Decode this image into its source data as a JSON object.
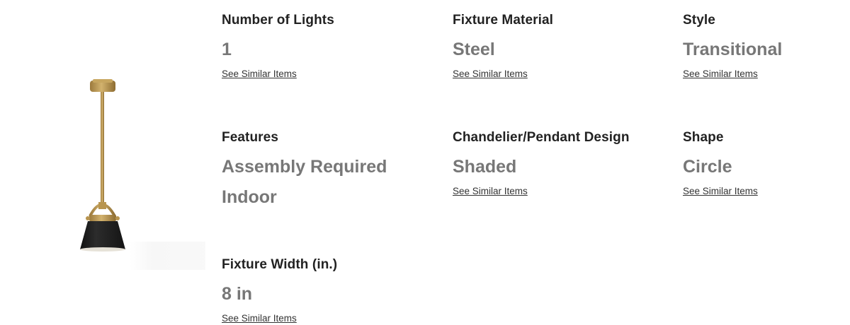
{
  "specs": {
    "number_of_lights": {
      "title": "Number of Lights",
      "value": "1",
      "link": "See Similar Items"
    },
    "fixture_material": {
      "title": "Fixture Material",
      "value": "Steel",
      "link": "See Similar Items"
    },
    "style": {
      "title": "Style",
      "value": "Transitional",
      "link": "See Similar Items"
    },
    "features": {
      "title": "Features",
      "values": [
        "Assembly Required",
        "Indoor"
      ]
    },
    "pendant_design": {
      "title": "Chandelier/Pendant Design",
      "value": "Shaded",
      "link": "See Similar Items"
    },
    "shape": {
      "title": "Shape",
      "value": "Circle",
      "link": "See Similar Items"
    },
    "fixture_width": {
      "title": "Fixture Width (in.)",
      "value": "8 in",
      "link": "See Similar Items"
    }
  },
  "colors": {
    "title": "#222222",
    "value": "#777777",
    "link": "#333333",
    "brass": "#b8954f",
    "shade": "#1e1e1e"
  },
  "image": {
    "icon": "pendant-light-icon"
  }
}
